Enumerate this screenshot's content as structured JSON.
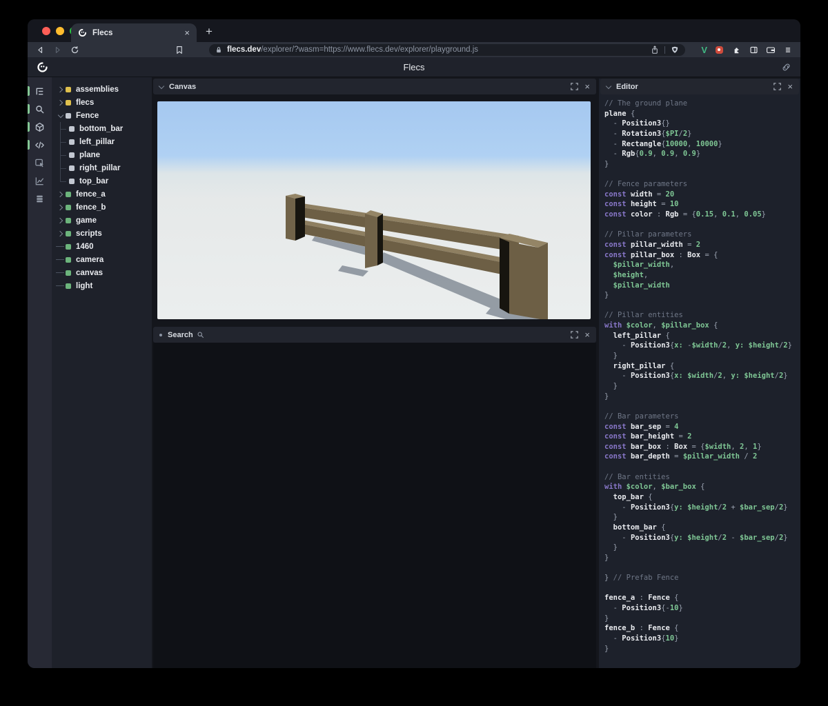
{
  "browser": {
    "tab_title": "Flecs",
    "tab_close": "×",
    "new_tab": "+",
    "url_host": "flecs.dev",
    "url_path": "/explorer/?wasm=https://www.flecs.dev/explorer/playground.js",
    "icons": [
      "back-icon",
      "forward-icon",
      "reload-icon",
      "bookmark-icon",
      "lock-icon",
      "share-icon",
      "brave-shield-icon",
      "vue-devtools-icon",
      "red-extension-icon",
      "extensions-puzzle-icon",
      "side-panel-icon",
      "wallet-icon",
      "menu-icon"
    ],
    "vue_badge": "V",
    "traffic_lights": [
      "#ff5f57",
      "#febc2e",
      "#28c840"
    ]
  },
  "page": {
    "title": "Flecs",
    "logo_icon": "flecs-logo-icon",
    "link_icon": "link-icon"
  },
  "rail": {
    "items": [
      {
        "icon": "tree-icon",
        "active": true
      },
      {
        "icon": "search-icon",
        "active": true
      },
      {
        "icon": "cube-icon",
        "active": true
      },
      {
        "icon": "code-icon",
        "active": true
      },
      {
        "icon": "inspector-icon",
        "active": false
      },
      {
        "icon": "chart-icon",
        "active": false
      },
      {
        "icon": "stack-icon",
        "active": false
      }
    ],
    "active_color": "#84c795"
  },
  "tree": {
    "items": [
      {
        "label": "assemblies",
        "dot": "#dfc04d",
        "state": "collapsed"
      },
      {
        "label": "flecs",
        "dot": "#dfc04d",
        "state": "collapsed"
      },
      {
        "label": "Fence",
        "dot": "#c3c8d1",
        "state": "expanded"
      },
      {
        "label": "bottom_bar",
        "dot": "#c3c8d1",
        "state": "child"
      },
      {
        "label": "left_pillar",
        "dot": "#c3c8d1",
        "state": "child"
      },
      {
        "label": "plane",
        "dot": "#c3c8d1",
        "state": "child"
      },
      {
        "label": "right_pillar",
        "dot": "#c3c8d1",
        "state": "child"
      },
      {
        "label": "top_bar",
        "dot": "#c3c8d1",
        "state": "child",
        "last": true
      },
      {
        "label": "fence_a",
        "dot": "#6cb47c",
        "state": "collapsed"
      },
      {
        "label": "fence_b",
        "dot": "#6cb47c",
        "state": "collapsed"
      },
      {
        "label": "game",
        "dot": "#6cb47c",
        "state": "collapsed"
      },
      {
        "label": "scripts",
        "dot": "#6cb47c",
        "state": "collapsed"
      },
      {
        "label": "1460",
        "dot": "#6cb47c",
        "state": "leaf"
      },
      {
        "label": "camera",
        "dot": "#6cb47c",
        "state": "leaf"
      },
      {
        "label": "canvas",
        "dot": "#6cb47c",
        "state": "leaf"
      },
      {
        "label": "light",
        "dot": "#6cb47c",
        "state": "leaf"
      }
    ]
  },
  "panels": {
    "canvas": {
      "title": "Canvas"
    },
    "search": {
      "title": "Search"
    },
    "editor": {
      "title": "Editor"
    }
  },
  "scene": {
    "sky": "#a5c8f0",
    "sky_low": "#b0d1f3",
    "horizon": "#dde5e8",
    "ground": "#e6e9e9",
    "ground_low": "#ebeeee",
    "wood": "#6d5f45",
    "wood_light": "#8e7f61",
    "wood_mid": "#716349",
    "wood_dark": "#17150f",
    "pillar_top": "#948566",
    "shadow": "#4e5a6a"
  },
  "editor": {
    "lines": [
      [
        [
          "c",
          "// The ground plane"
        ]
      ],
      [
        [
          "n",
          "plane "
        ],
        [
          "p",
          "{"
        ]
      ],
      [
        [
          "p",
          "  - "
        ],
        [
          "n",
          "Position3"
        ],
        [
          "p",
          "{}"
        ]
      ],
      [
        [
          "p",
          "  - "
        ],
        [
          "n",
          "Rotation3"
        ],
        [
          "p",
          "{"
        ],
        [
          "v",
          "$PI"
        ],
        [
          "p",
          "/"
        ],
        [
          "v",
          "2"
        ],
        [
          "p",
          "}"
        ]
      ],
      [
        [
          "p",
          "  - "
        ],
        [
          "n",
          "Rectangle"
        ],
        [
          "p",
          "{"
        ],
        [
          "v",
          "10000"
        ],
        [
          "p",
          ", "
        ],
        [
          "v",
          "10000"
        ],
        [
          "p",
          "}"
        ]
      ],
      [
        [
          "p",
          "  - "
        ],
        [
          "n",
          "Rgb"
        ],
        [
          "p",
          "{"
        ],
        [
          "v",
          "0.9"
        ],
        [
          "p",
          ", "
        ],
        [
          "v",
          "0.9"
        ],
        [
          "p",
          ", "
        ],
        [
          "v",
          "0.9"
        ],
        [
          "p",
          "}"
        ]
      ],
      [
        [
          "p",
          "}"
        ]
      ],
      [],
      [
        [
          "c",
          "// Fence parameters"
        ]
      ],
      [
        [
          "k",
          "const "
        ],
        [
          "n",
          "width "
        ],
        [
          "p",
          "= "
        ],
        [
          "v",
          "20"
        ]
      ],
      [
        [
          "k",
          "const "
        ],
        [
          "n",
          "height "
        ],
        [
          "p",
          "= "
        ],
        [
          "v",
          "10"
        ]
      ],
      [
        [
          "k",
          "const "
        ],
        [
          "n",
          "color "
        ],
        [
          "p",
          ": "
        ],
        [
          "n",
          "Rgb "
        ],
        [
          "p",
          "= {"
        ],
        [
          "v",
          "0.15"
        ],
        [
          "p",
          ", "
        ],
        [
          "v",
          "0.1"
        ],
        [
          "p",
          ", "
        ],
        [
          "v",
          "0.05"
        ],
        [
          "p",
          "}"
        ]
      ],
      [],
      [
        [
          "c",
          "// Pillar parameters"
        ]
      ],
      [
        [
          "k",
          "const "
        ],
        [
          "n",
          "pillar_width "
        ],
        [
          "p",
          "= "
        ],
        [
          "v",
          "2"
        ]
      ],
      [
        [
          "k",
          "const "
        ],
        [
          "n",
          "pillar_box "
        ],
        [
          "p",
          ": "
        ],
        [
          "n",
          "Box "
        ],
        [
          "p",
          "= {"
        ]
      ],
      [
        [
          "v",
          "  $pillar_width"
        ],
        [
          "p",
          ","
        ]
      ],
      [
        [
          "v",
          "  $height"
        ],
        [
          "p",
          ","
        ]
      ],
      [
        [
          "v",
          "  $pillar_width"
        ]
      ],
      [
        [
          "p",
          "}"
        ]
      ],
      [],
      [
        [
          "c",
          "// Pillar entities"
        ]
      ],
      [
        [
          "k",
          "with "
        ],
        [
          "v",
          "$color"
        ],
        [
          "p",
          ", "
        ],
        [
          "v",
          "$pillar_box "
        ],
        [
          "p",
          "{"
        ]
      ],
      [
        [
          "n",
          "  left_pillar "
        ],
        [
          "p",
          "{"
        ]
      ],
      [
        [
          "p",
          "    - "
        ],
        [
          "n",
          "Position3"
        ],
        [
          "p",
          "{"
        ],
        [
          "v",
          "x: "
        ],
        [
          "p",
          "-"
        ],
        [
          "v",
          "$width"
        ],
        [
          "p",
          "/"
        ],
        [
          "v",
          "2"
        ],
        [
          "p",
          ", "
        ],
        [
          "v",
          "y: $height"
        ],
        [
          "p",
          "/"
        ],
        [
          "v",
          "2"
        ],
        [
          "p",
          "}"
        ]
      ],
      [
        [
          "p",
          "  }"
        ]
      ],
      [
        [
          "n",
          "  right_pillar "
        ],
        [
          "p",
          "{"
        ]
      ],
      [
        [
          "p",
          "    - "
        ],
        [
          "n",
          "Position3"
        ],
        [
          "p",
          "{"
        ],
        [
          "v",
          "x: $width"
        ],
        [
          "p",
          "/"
        ],
        [
          "v",
          "2"
        ],
        [
          "p",
          ", "
        ],
        [
          "v",
          "y: $height"
        ],
        [
          "p",
          "/"
        ],
        [
          "v",
          "2"
        ],
        [
          "p",
          "}"
        ]
      ],
      [
        [
          "p",
          "  }"
        ]
      ],
      [
        [
          "p",
          "}"
        ]
      ],
      [],
      [
        [
          "c",
          "// Bar parameters"
        ]
      ],
      [
        [
          "k",
          "const "
        ],
        [
          "n",
          "bar_sep "
        ],
        [
          "p",
          "= "
        ],
        [
          "v",
          "4"
        ]
      ],
      [
        [
          "k",
          "const "
        ],
        [
          "n",
          "bar_height "
        ],
        [
          "p",
          "= "
        ],
        [
          "v",
          "2"
        ]
      ],
      [
        [
          "k",
          "const "
        ],
        [
          "n",
          "bar_box "
        ],
        [
          "p",
          ": "
        ],
        [
          "n",
          "Box "
        ],
        [
          "p",
          "= {"
        ],
        [
          "v",
          "$width"
        ],
        [
          "p",
          ", "
        ],
        [
          "v",
          "2"
        ],
        [
          "p",
          ", "
        ],
        [
          "v",
          "1"
        ],
        [
          "p",
          "}"
        ]
      ],
      [
        [
          "k",
          "const "
        ],
        [
          "n",
          "bar_depth "
        ],
        [
          "p",
          "= "
        ],
        [
          "v",
          "$pillar_width "
        ],
        [
          "p",
          "/ "
        ],
        [
          "v",
          "2"
        ]
      ],
      [],
      [
        [
          "c",
          "// Bar entities"
        ]
      ],
      [
        [
          "k",
          "with "
        ],
        [
          "v",
          "$color"
        ],
        [
          "p",
          ", "
        ],
        [
          "v",
          "$bar_box "
        ],
        [
          "p",
          "{"
        ]
      ],
      [
        [
          "n",
          "  top_bar "
        ],
        [
          "p",
          "{"
        ]
      ],
      [
        [
          "p",
          "    - "
        ],
        [
          "n",
          "Position3"
        ],
        [
          "p",
          "{"
        ],
        [
          "v",
          "y: $height"
        ],
        [
          "p",
          "/"
        ],
        [
          "v",
          "2 "
        ],
        [
          "p",
          "+ "
        ],
        [
          "v",
          "$bar_sep"
        ],
        [
          "p",
          "/"
        ],
        [
          "v",
          "2"
        ],
        [
          "p",
          "}"
        ]
      ],
      [
        [
          "p",
          "  }"
        ]
      ],
      [
        [
          "n",
          "  bottom_bar "
        ],
        [
          "p",
          "{"
        ]
      ],
      [
        [
          "p",
          "    - "
        ],
        [
          "n",
          "Position3"
        ],
        [
          "p",
          "{"
        ],
        [
          "v",
          "y: $height"
        ],
        [
          "p",
          "/"
        ],
        [
          "v",
          "2 "
        ],
        [
          "p",
          "- "
        ],
        [
          "v",
          "$bar_sep"
        ],
        [
          "p",
          "/"
        ],
        [
          "v",
          "2"
        ],
        [
          "p",
          "}"
        ]
      ],
      [
        [
          "p",
          "  }"
        ]
      ],
      [
        [
          "p",
          "}"
        ]
      ],
      [],
      [
        [
          "p",
          "} "
        ],
        [
          "c",
          "// Prefab Fence"
        ]
      ],
      [],
      [
        [
          "n",
          "fence_a "
        ],
        [
          "p",
          ": "
        ],
        [
          "n",
          "Fence "
        ],
        [
          "p",
          "{"
        ]
      ],
      [
        [
          "p",
          "  - "
        ],
        [
          "n",
          "Position3"
        ],
        [
          "p",
          "{-"
        ],
        [
          "v",
          "10"
        ],
        [
          "p",
          "}"
        ]
      ],
      [
        [
          "p",
          "}"
        ]
      ],
      [
        [
          "n",
          "fence_b "
        ],
        [
          "p",
          ": "
        ],
        [
          "n",
          "Fence "
        ],
        [
          "p",
          "{"
        ]
      ],
      [
        [
          "p",
          "  - "
        ],
        [
          "n",
          "Position3"
        ],
        [
          "p",
          "{"
        ],
        [
          "v",
          "10"
        ],
        [
          "p",
          "}"
        ]
      ],
      [
        [
          "p",
          "}"
        ]
      ]
    ]
  }
}
